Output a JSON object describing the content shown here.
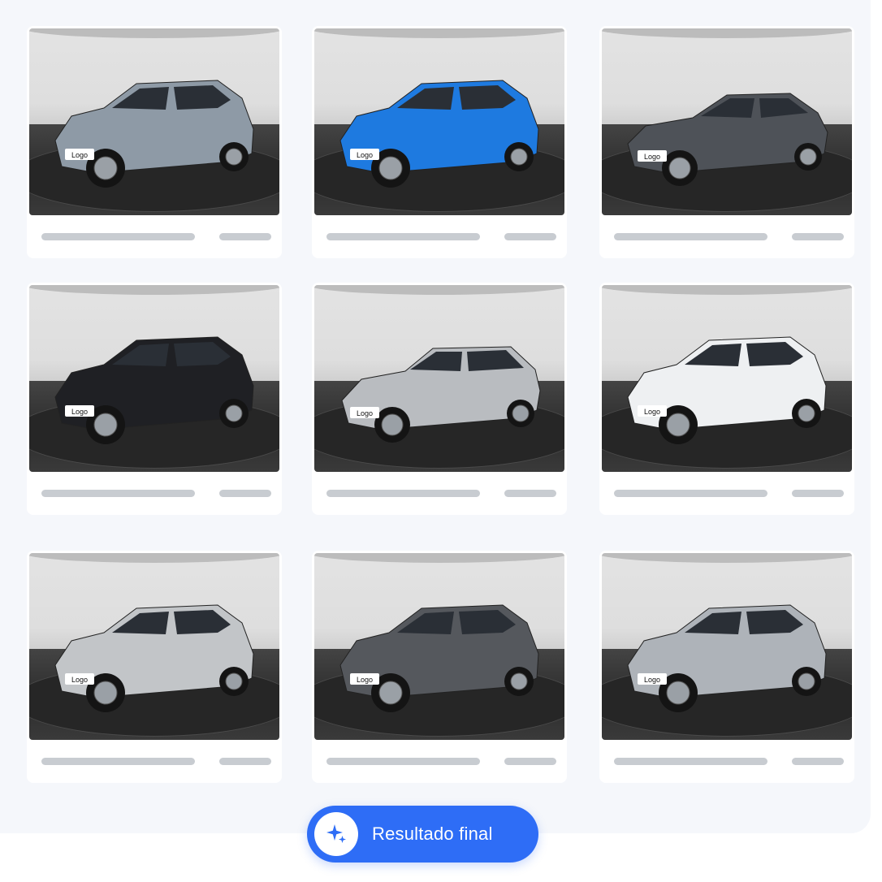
{
  "cta": {
    "label": "Resultado final",
    "icon": "sparkles-icon",
    "color": "#2e6df6"
  },
  "cards": [
    {
      "body_color": "#8e9aa6",
      "plate_text": "Logo",
      "type": "suv"
    },
    {
      "body_color": "#1e7ae0",
      "plate_text": "Logo",
      "type": "suv"
    },
    {
      "body_color": "#4e5258",
      "plate_text": "Logo",
      "type": "sedan"
    },
    {
      "body_color": "#1f2024",
      "plate_text": "Logo",
      "type": "suv"
    },
    {
      "body_color": "#b9bcc0",
      "plate_text": "Logo",
      "type": "hatch"
    },
    {
      "body_color": "#eef0f2",
      "plate_text": "Logo",
      "type": "suv"
    },
    {
      "body_color": "#c2c5c8",
      "plate_text": "Logo",
      "type": "suv"
    },
    {
      "body_color": "#55585d",
      "plate_text": "Logo",
      "type": "suv"
    },
    {
      "body_color": "#aeb3b9",
      "plate_text": "Logo",
      "type": "suv"
    }
  ]
}
